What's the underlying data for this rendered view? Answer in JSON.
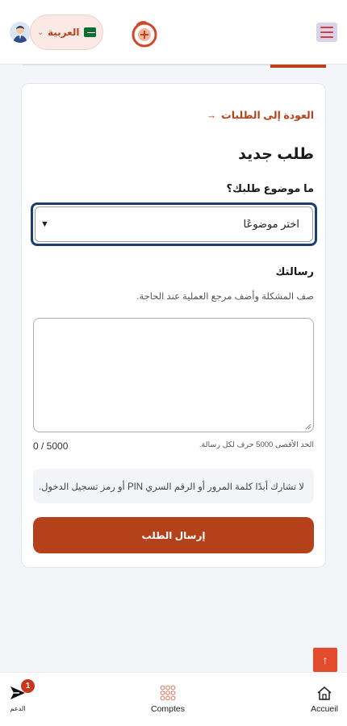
{
  "header": {
    "language_label": "العربية",
    "language_flag": "flag-sa-icon",
    "logo": "brand-logo",
    "menu_icon": "hamburger-menu-icon"
  },
  "form": {
    "back_label": "العودة إلى الطلبات",
    "back_arrow": "→",
    "title": "طلب جديد",
    "subject_label": "ما موضوع طلبك؟",
    "subject_value": "اختر موضوعًا",
    "message_label": "رسالتك",
    "message_help": "صف المشكلة وأضف مرجع العملية عند الحاجة.",
    "message_value": "",
    "counter": "0 / 5000",
    "limit_note": "الحد الأقصى 5000 حرف لكل رسالة.",
    "warning": "لا تشارك أبدًا كلمة المرور أو الرقم السري PIN أو رمز تسجيل الدخول.",
    "submit_label": "إرسال الطلب"
  },
  "scroll_top": {
    "icon": "arrow-up-icon",
    "glyph": "↑"
  },
  "bottom_nav": {
    "support_label": "الدعم",
    "support_badge": "1",
    "comptes_label": "Comptes",
    "accueil_label": "Accueil"
  },
  "colors": {
    "accent": "#b5411a",
    "focus_border": "#1b3e6e",
    "scroll_button": "#e24c2c",
    "menu_bg": "#d9d3e8",
    "badge": "#c8371d"
  }
}
